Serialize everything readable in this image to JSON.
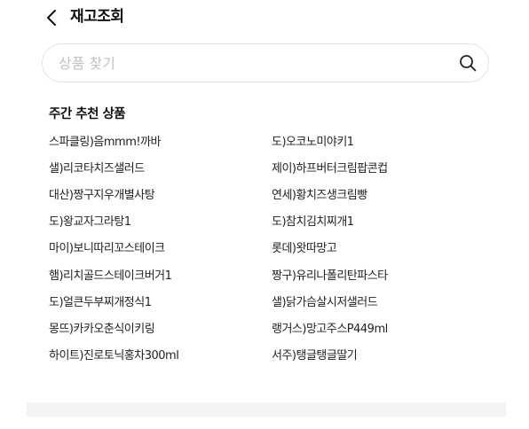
{
  "header": {
    "title": "재고조회",
    "back_icon": "chevron-left-icon"
  },
  "search": {
    "placeholder": "상품 찾기",
    "value": "",
    "icon": "search-icon"
  },
  "section": {
    "title": "주간 추천 상품"
  },
  "products": [
    [
      "스파클링)음mmm!까바",
      "도)오코노미야키1"
    ],
    [
      "샐)리코타치즈샐러드",
      "제이)하프버터크림팝콘컵"
    ],
    [
      "대산)짱구지우개별사탕",
      "연세)황치즈생크림빵"
    ],
    [
      "도)왕교자그라탕1",
      "도)참치김치찌개1"
    ],
    [
      "마이)보니따리꼬스테이크",
      "롯데)왓따망고"
    ],
    [
      "햄)리치골드스테이크버거1",
      "짱구)유리나폴리탄파스타"
    ],
    [
      "도)얼큰두부찌개정식1",
      "샐)닭가슴살시저샐러드"
    ],
    [
      "몽뜨)카카오춘식이키링",
      "랭거스)망고주스P449ml"
    ],
    [
      "하이트)진로토닉홍차300ml",
      "서주)탱글탱글딸기"
    ]
  ]
}
